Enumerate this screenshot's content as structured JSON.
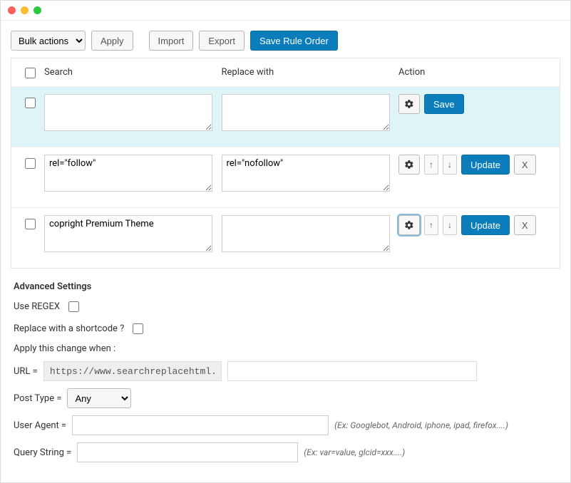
{
  "toolbar": {
    "bulk_actions": "Bulk actions",
    "apply": "Apply",
    "import": "Import",
    "export": "Export",
    "save_order": "Save Rule Order"
  },
  "columns": {
    "search": "Search",
    "replace": "Replace with",
    "action": "Action"
  },
  "rows": [
    {
      "search": "",
      "replace": "",
      "button": "Save",
      "is_new": true,
      "gear_active": false
    },
    {
      "search": "rel=\"follow\"",
      "replace": "rel=\"nofollow\"",
      "button": "Update",
      "is_new": false,
      "gear_active": false
    },
    {
      "search": "copright Premium Theme",
      "replace": "",
      "button": "Update",
      "is_new": false,
      "gear_active": true
    }
  ],
  "row_labels": {
    "delete": "X",
    "up": "↑",
    "down": "↓",
    "gear": "✿"
  },
  "advanced": {
    "heading": "Advanced Settings",
    "use_regex": "Use REGEX",
    "replace_shortcode": "Replace with a shortcode ?",
    "apply_when": "Apply this change when :",
    "url_label": "URL =",
    "url_value": "https://www.searchreplacehtml.com",
    "post_type_label": "Post Type =",
    "post_type_value": "Any",
    "user_agent_label": "User Agent =",
    "user_agent_hint": "(Ex: Googlebot, Android, iphone, ipad, firefox....)",
    "query_string_label": "Query String =",
    "query_string_hint": "(Ex: var=value, glcid=xxx....)"
  }
}
